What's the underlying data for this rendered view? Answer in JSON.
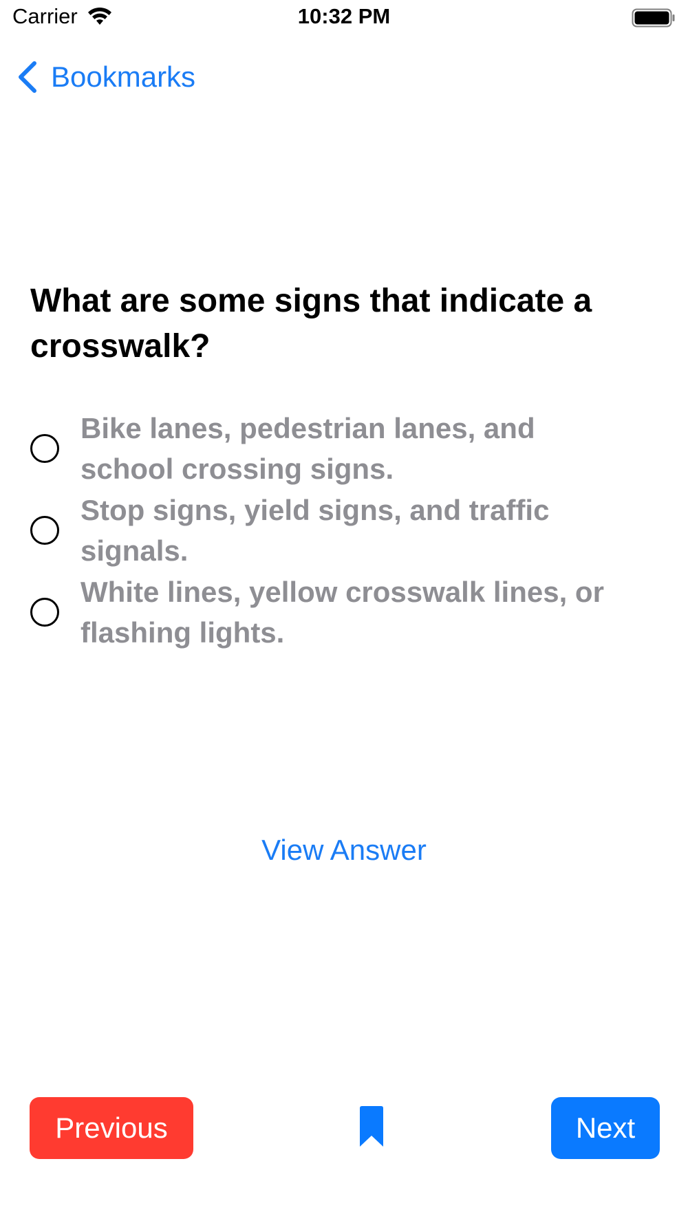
{
  "status_bar": {
    "carrier": "Carrier",
    "time": "10:32 PM",
    "wifi_icon": "wifi-icon",
    "battery_icon": "battery-icon"
  },
  "nav": {
    "back_label": "Bookmarks",
    "back_icon": "chevron-left-icon"
  },
  "question": {
    "text": "What are some signs that indicate a crosswalk?"
  },
  "options": [
    {
      "text": "Bike lanes, pedestrian lanes, and school crossing signs."
    },
    {
      "text": "Stop signs, yield signs, and traffic signals."
    },
    {
      "text": "White lines, yellow crosswalk lines, or flashing lights."
    }
  ],
  "view_answer": {
    "label": "View Answer"
  },
  "footer": {
    "previous_label": "Previous",
    "next_label": "Next",
    "bookmark_icon": "bookmark-icon"
  },
  "colors": {
    "accent": "#1a7cf5",
    "previous_button": "#ff3b30",
    "next_button": "#0a7aff",
    "option_text": "#8e8e93"
  }
}
